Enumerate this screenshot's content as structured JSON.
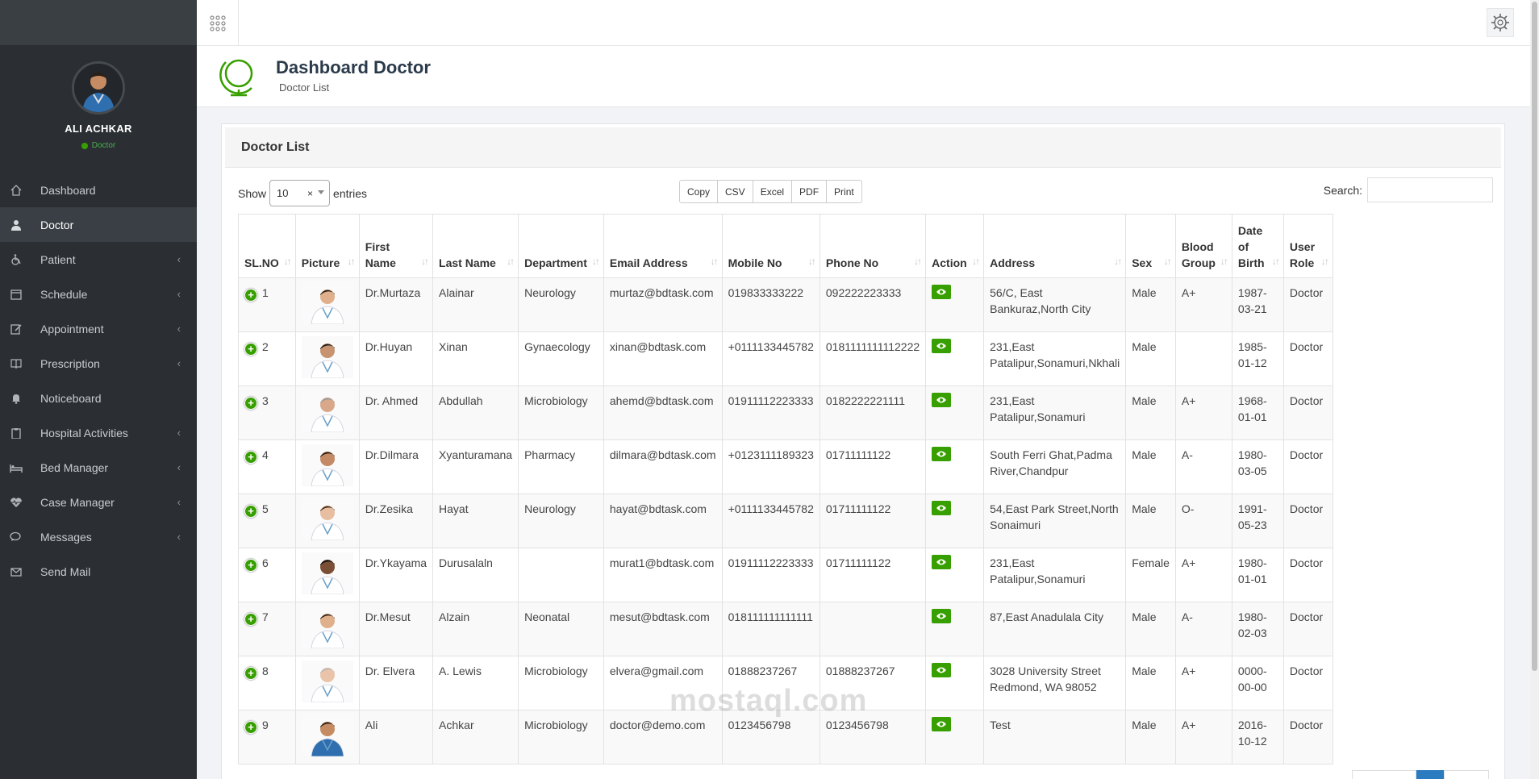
{
  "user": {
    "name": "ALI ACHKAR",
    "role": "Doctor"
  },
  "nav": [
    {
      "label": "Dashboard",
      "icon": "home-icon",
      "chevron": false,
      "active": false
    },
    {
      "label": "Doctor",
      "icon": "user-md-icon",
      "chevron": false,
      "active": true
    },
    {
      "label": "Patient",
      "icon": "wheelchair-icon",
      "chevron": true,
      "active": false
    },
    {
      "label": "Schedule",
      "icon": "calendar-icon",
      "chevron": true,
      "active": false
    },
    {
      "label": "Appointment",
      "icon": "edit-icon",
      "chevron": true,
      "active": false
    },
    {
      "label": "Prescription",
      "icon": "book-icon",
      "chevron": true,
      "active": false
    },
    {
      "label": "Noticeboard",
      "icon": "bell-icon",
      "chevron": false,
      "active": false
    },
    {
      "label": "Hospital Activities",
      "icon": "clipboard-icon",
      "chevron": true,
      "active": false
    },
    {
      "label": "Bed Manager",
      "icon": "bed-icon",
      "chevron": true,
      "active": false
    },
    {
      "label": "Case Manager",
      "icon": "heartbeat-icon",
      "chevron": true,
      "active": false
    },
    {
      "label": "Messages",
      "icon": "comments-icon",
      "chevron": true,
      "active": false
    },
    {
      "label": "Send Mail",
      "icon": "envelope-icon",
      "chevron": false,
      "active": false
    }
  ],
  "page": {
    "title": "Dashboard Doctor",
    "subtitle": "Doctor List"
  },
  "card": {
    "title": "Doctor List"
  },
  "controls": {
    "show_label": "Show",
    "entries_value": "10",
    "entries_label": "entries",
    "export_buttons": [
      "Copy",
      "CSV",
      "Excel",
      "PDF",
      "Print"
    ],
    "search_label": "Search:",
    "search_value": ""
  },
  "columns": [
    "SL.NO",
    "Picture",
    "First Name",
    "Last Name",
    "Department",
    "Email Address",
    "Mobile No",
    "Phone No",
    "Action",
    "Address",
    "Sex",
    "Blood Group",
    "Date of Birth",
    "User Role"
  ],
  "rows": [
    {
      "sl": "1",
      "first": "Dr.Murtaza",
      "last": "Alainar",
      "dept": "Neurology",
      "email": "murtaz@bdtask.com",
      "mobile": "019833333222",
      "phone": "092222223333",
      "address": "56/C, East Bankuraz,North City",
      "sex": "Male",
      "blood": "A+",
      "dob": "1987-03-21",
      "role": "Doctor"
    },
    {
      "sl": "2",
      "first": "Dr.Huyan",
      "last": "Xinan",
      "dept": "Gynaecology",
      "email": "xinan@bdtask.com",
      "mobile": "+0111133445782",
      "phone": "0181111111112222",
      "address": "231,East Patalipur,Sonamuri,Nkhali",
      "sex": "Male",
      "blood": "",
      "dob": "1985-01-12",
      "role": "Doctor"
    },
    {
      "sl": "3",
      "first": "Dr. Ahmed",
      "last": "Abdullah",
      "dept": "Microbiology",
      "email": "ahemd@bdtask.com",
      "mobile": "01911112223333",
      "phone": "0182222221111",
      "address": "231,East Patalipur,Sonamuri",
      "sex": "Male",
      "blood": "A+",
      "dob": "1968-01-01",
      "role": "Doctor"
    },
    {
      "sl": "4",
      "first": "Dr.Dilmara",
      "last": "Xyanturamana",
      "dept": "Pharmacy",
      "email": "dilmara@bdtask.com",
      "mobile": "+0123111189323",
      "phone": "01711111122",
      "address": "South Ferri Ghat,Padma River,Chandpur",
      "sex": "Male",
      "blood": "A-",
      "dob": "1980-03-05",
      "role": "Doctor"
    },
    {
      "sl": "5",
      "first": "Dr.Zesika",
      "last": "Hayat",
      "dept": "Neurology",
      "email": "hayat@bdtask.com",
      "mobile": "+0111133445782",
      "phone": "01711111122",
      "address": "54,East Park Street,North Sonaimuri",
      "sex": "Male",
      "blood": "O-",
      "dob": "1991-05-23",
      "role": "Doctor"
    },
    {
      "sl": "6",
      "first": "Dr.Ykayama",
      "last": "Durusalaln",
      "dept": "",
      "email": "murat1@bdtask.com",
      "mobile": "01911112223333",
      "phone": "01711111122",
      "address": "231,East Patalipur,Sonamuri",
      "sex": "Female",
      "blood": "A+",
      "dob": "1980-01-01",
      "role": "Doctor"
    },
    {
      "sl": "7",
      "first": "Dr.Mesut",
      "last": "Alzain",
      "dept": "Neonatal",
      "email": "mesut@bdtask.com",
      "mobile": "018111111111111",
      "phone": "",
      "address": "87,East Anadulala City",
      "sex": "Male",
      "blood": "A-",
      "dob": "1980-02-03",
      "role": "Doctor"
    },
    {
      "sl": "8",
      "first": "Dr. Elvera",
      "last": "A. Lewis",
      "dept": "Microbiology",
      "email": "elvera@gmail.com",
      "mobile": "01888237267",
      "phone": "01888237267",
      "address": "3028 University Street Redmond, WA 98052",
      "sex": "Male",
      "blood": "A+",
      "dob": "0000-00-00",
      "role": "Doctor"
    },
    {
      "sl": "9",
      "first": "Ali",
      "last": "Achkar",
      "dept": "Microbiology",
      "email": "doctor@demo.com",
      "mobile": "0123456798",
      "phone": "0123456798",
      "address": "Test",
      "sex": "Male",
      "blood": "A+",
      "dob": "2016-10-12",
      "role": "Doctor"
    }
  ],
  "watermark": "mostaql.com",
  "colors": {
    "accent": "#37a000",
    "sidebar": "#2b2f33",
    "pagination_active": "#2a7bc0"
  }
}
